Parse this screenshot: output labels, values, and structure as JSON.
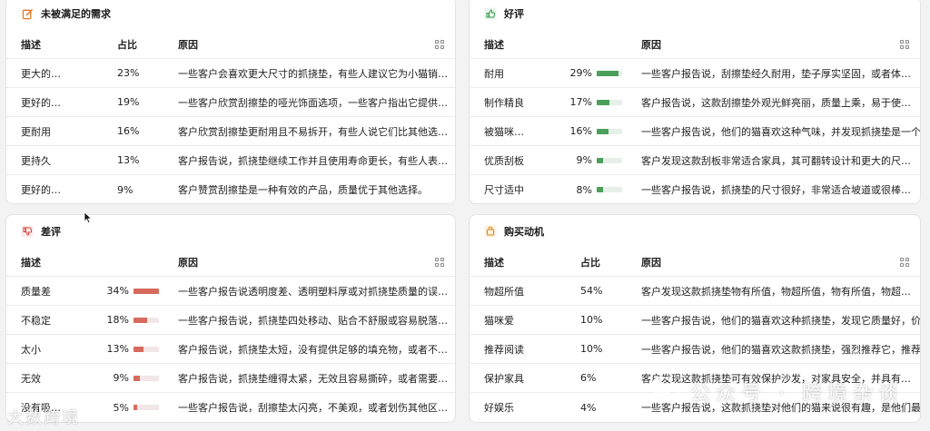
{
  "unmet_needs": {
    "title": "未被满足的需求",
    "icon": "edit-icon",
    "headers": {
      "desc": "描述",
      "pct": "占比",
      "reason": "原因"
    },
    "rows": [
      {
        "desc": "更大的…",
        "pct": "23%",
        "reason": "一些客户会喜欢更大尺寸的抓挠垫，有些人建议它为小猫销…"
      },
      {
        "desc": "更好的…",
        "pct": "19%",
        "reason": "一些客户欣赏刮擦垫的哑光饰面选项，一些客户指出它提供…"
      },
      {
        "desc": "更耐用",
        "pct": "16%",
        "reason": "客户欣赏刮擦垫更耐用且不易拆开，有些人说它们比其他选…"
      },
      {
        "desc": "更持久",
        "pct": "13%",
        "reason": "客户报告说，抓挠垫继续工作并且使用寿命更长，有些人表…"
      },
      {
        "desc": "更好的…",
        "pct": "9%",
        "reason": "客户赞赏刮擦垫是一种有效的产品，质量优于其他选择。"
      }
    ]
  },
  "positive": {
    "title": "好评",
    "icon": "thumbs-up-icon",
    "headers": {
      "desc": "描述",
      "reason": "原因"
    },
    "rows": [
      {
        "desc": "耐用",
        "pct": "29%",
        "value": 0.29,
        "reason": "一些客户报告说，刮擦垫经久耐用，垫子厚实坚固，或者体…"
      },
      {
        "desc": "制作精良",
        "pct": "17%",
        "value": 0.17,
        "reason": "客户报告说，这款刮擦垫外观光鲜亮丽，质量上乘，易于使…"
      },
      {
        "desc": "被猫咪…",
        "pct": "16%",
        "value": 0.16,
        "reason": "一些客户报告说，他们的猫喜欢这种气味，并发现抓挠垫是一个…"
      },
      {
        "desc": "优质刮板",
        "pct": "9%",
        "value": 0.09,
        "reason": "客户发现这款刮板非常适合家具，其可翻转设计和更大的尺…"
      },
      {
        "desc": "尺寸适中",
        "pct": "8%",
        "value": 0.08,
        "reason": "一些客户报告说，抓挠垫的尺寸很好，非常适合坡道或很棒…"
      }
    ]
  },
  "negative": {
    "title": "差评",
    "icon": "thumbs-down-icon",
    "headers": {
      "desc": "描述",
      "reason": "原因"
    },
    "rows": [
      {
        "desc": "质量差",
        "pct": "34%",
        "value": 0.34,
        "reason": "一些客户报告说透明度差、透明塑料厚或对抓挠垫质量的误…"
      },
      {
        "desc": "不稳定",
        "pct": "18%",
        "value": 0.18,
        "reason": "一些客户报告说，抓挠垫四处移动、贴合不舒服或容易脱落…"
      },
      {
        "desc": "太小",
        "pct": "13%",
        "value": 0.13,
        "reason": "客户报告说，抓挠垫太短，没有提供足够的填充物，或者不…"
      },
      {
        "desc": "无效",
        "pct": "9%",
        "value": 0.09,
        "reason": "客户报告说，抓挠垫缠得太紧，无效且容易撕碎，或者需要…"
      },
      {
        "desc": "没有吸…",
        "pct": "5%",
        "value": 0.05,
        "reason": "一些客户报告说，刮擦垫太闪亮，不美观，或者划伤其他区…"
      }
    ]
  },
  "motivation": {
    "title": "购买动机",
    "icon": "shopping-bag-icon",
    "headers": {
      "desc": "描述",
      "pct": "占比",
      "reason": "原因"
    },
    "rows": [
      {
        "desc": "物超所值",
        "pct": "54%",
        "reason": "客户发现这款抓挠垫物有所值，物超所值，物有所值，物超…"
      },
      {
        "desc": "猫咪爱",
        "pct": "10%",
        "reason": "一些客户报告说，他们的猫喜欢这种抓挠垫，发现它质量好，价…"
      },
      {
        "desc": "推荐阅读",
        "pct": "10%",
        "reason": "一些客户报告说，他们的猫喜欢这款抓挠垫，强烈推荐它，推荐…"
      },
      {
        "desc": "保护家具",
        "pct": "6%",
        "reason": "客户发现这款抓挠垫可有效保护沙发，对家具安全，并具有…"
      },
      {
        "desc": "好娱乐",
        "pct": "4%",
        "reason": "一些客户报告说，这款抓挠垫对他们的猫来说很有趣，是他们最喜欢…"
      }
    ]
  },
  "watermarks": {
    "left": "大数跨境",
    "right": "公众号 · 跨境杂谈"
  },
  "colors": {
    "negative_bar": "#d66a5c",
    "positive_bar": "#4aa05a"
  }
}
